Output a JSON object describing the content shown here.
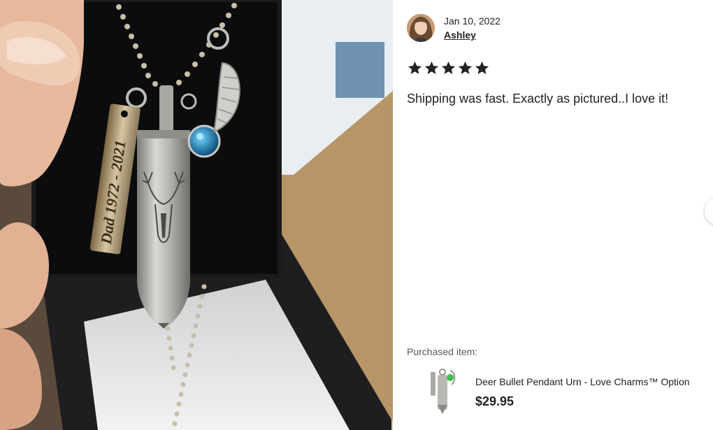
{
  "review": {
    "date": "Jan 10, 2022",
    "reviewer_name": "Ashley",
    "rating": 5,
    "text": "Shipping was fast. Exactly as pictured..I love it!"
  },
  "photo": {
    "engraving": "Dad 1972 - 2021"
  },
  "purchased": {
    "label": "Purchased item:",
    "title": "Deer Bullet Pendant Urn - Love Charms™ Option",
    "price": "$29.95"
  },
  "icons": {
    "star": "star-icon",
    "next": "chevron-right-icon"
  },
  "colors": {
    "star": "#222222",
    "text": "#222222",
    "muted": "#595959"
  }
}
